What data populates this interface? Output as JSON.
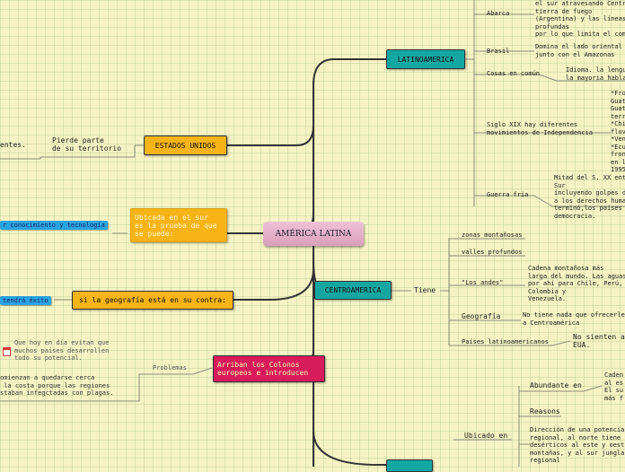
{
  "central": "AMÉRICA LATINA",
  "latam": {
    "label": "LATINOAMERICA",
    "abarca": "Abarca",
    "abarca_text": "el sur atravesando Centro\ntierra de fuego\n(Argentina) y las líneas c\nprofundas\npor lo que limita el comer",
    "brasil": "Brasil",
    "brasil_text": "Domina el lado oriental de\njunto con el Amazonas",
    "cosas": "Cosas en común",
    "cosas_text": "Idioma. la lengu\nla mayoria habla",
    "siglo": "Siglo XIX hay diferentes\nmovimientos de Independencia",
    "siglo_text": "*Fro\nGuat\nGuat\nterr\n*Chi\nfluv\n*Ven\n*Ecu\nfron\nen l\n1995",
    "guerra": "Guerra fria",
    "guerra_text": "Mitad del S. XX ent\nSur\nincluyendo golpes d\na los derechos huma\nterminó,los países\ndemocracia."
  },
  "centro": {
    "label": "CENTROAMERICA",
    "tiene": "Tiene",
    "zonas": "zonas montañosas",
    "valles": "valles profundos",
    "andes": "\"Los andes\"",
    "andes_text": "Cadena montañosa más\nlarga del mundo. Las aguas\npor ahí para Chile, Perú,\nColombia y\nVenezuela.",
    "geografia": "Geografía",
    "geografia_text": "No tiene nada que ofrecerle\na Centroamérica",
    "paises": "Países latinoamericanos",
    "paises_text": "No sienten af\nEUA."
  },
  "bottom": {
    "abundante": "Abundante en",
    "abundante_text": "Caden\nal es\nEl su\nmás f",
    "reasons": "Reasons",
    "direccion": "Dirección de una potencia\nregional, al norte tiene\ndesérticos al este y oest\nmontañas, y al sur jungla\nregional",
    "ubicado": "Ubicado en"
  },
  "eeuu": {
    "label": "ESTADOS UNIDOS",
    "pierde": "Pierde parte\nde su territorio",
    "entes": "entes."
  },
  "ubicada": {
    "label": "Ubicada en el sur\nes la prueba de que\nse puede:",
    "blue": "r conocimiento y tecnología"
  },
  "geo": {
    "label": "si la geografía está en su contra:",
    "blue": "tendrá éxito"
  },
  "colonos": {
    "label": "Arriban los Colonos\neuropeos e introducen",
    "problemas": "Problemas",
    "evitan": "Que hoy en día evitan que\nmuchos países desarrollen\ntodo su potencial.",
    "comienzan": "omienzan a quedarse cerca\n la costa porque las regiones\nstaban infegctadas con plagas."
  },
  "icons": {
    "calendar": "calendar-icon"
  },
  "colors": {
    "teal": "#14a7a2",
    "orange": "#f6b416",
    "crimson": "#d81c5b",
    "blue": "#29a3e0",
    "pink": "#e8b4cc"
  }
}
